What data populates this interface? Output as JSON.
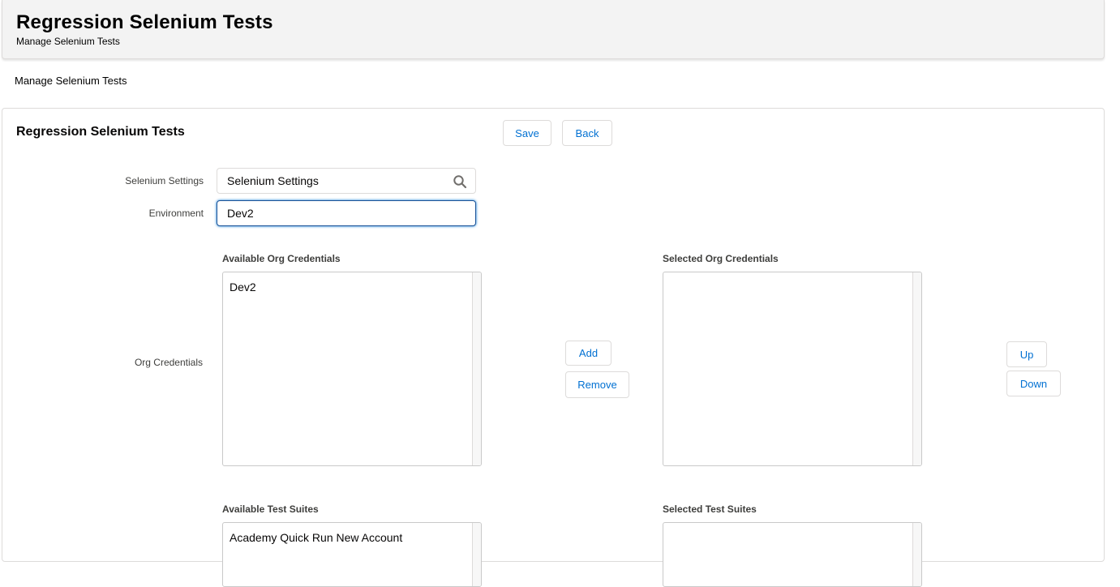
{
  "header": {
    "title": "Regression Selenium Tests",
    "subtitle": "Manage Selenium Tests"
  },
  "breadcrumb": "Manage Selenium Tests",
  "card": {
    "title": "Regression Selenium Tests",
    "save_label": "Save",
    "back_label": "Back"
  },
  "form": {
    "selenium_settings_label": "Selenium Settings",
    "selenium_settings_value": "Selenium Settings",
    "environment_label": "Environment",
    "environment_value": "Dev2",
    "org_credentials_label": "Org Credentials"
  },
  "org_credentials": {
    "available_heading": "Available Org Credentials",
    "selected_heading": "Selected Org Credentials",
    "available_items": [
      "Dev2"
    ],
    "selected_items": [],
    "add_label": "Add",
    "remove_label": "Remove",
    "up_label": "Up",
    "down_label": "Down"
  },
  "test_suites": {
    "available_heading": "Available Test Suites",
    "selected_heading": "Selected Test Suites",
    "available_items": [
      "Academy Quick Run New Account"
    ],
    "selected_items": []
  },
  "icons": {
    "lookup": "search-icon"
  },
  "colors": {
    "brand_link": "#0070d2",
    "focus_border": "#1b5297",
    "header_bg": "#f3f3f3"
  }
}
